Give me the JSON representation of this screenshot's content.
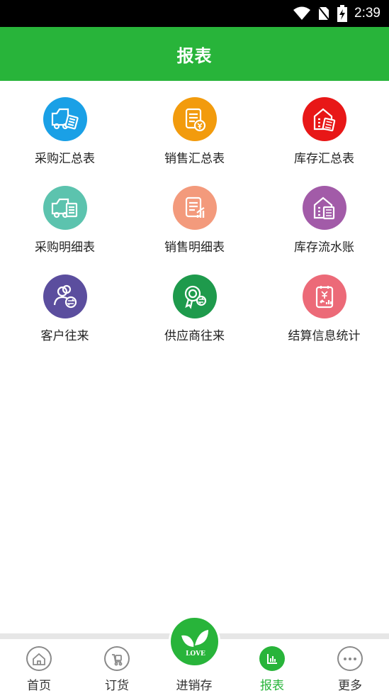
{
  "status_bar": {
    "time": "2:39"
  },
  "header": {
    "title": "报表"
  },
  "colors": {
    "accent": "#28b43a"
  },
  "grid": [
    {
      "label": "采购汇总表",
      "icon": "truck-calculator-icon",
      "color": "#1aa0e6"
    },
    {
      "label": "销售汇总表",
      "icon": "document-yuan-icon",
      "color": "#f29b0d"
    },
    {
      "label": "库存汇总表",
      "icon": "warehouse-calculator-icon",
      "color": "#e81717"
    },
    {
      "label": "采购明细表",
      "icon": "truck-list-icon",
      "color": "#5cc3ae"
    },
    {
      "label": "销售明细表",
      "icon": "document-chart-icon",
      "color": "#f39a7c"
    },
    {
      "label": "库存流水账",
      "icon": "warehouse-list-icon",
      "color": "#a25ba8"
    },
    {
      "label": "客户往来",
      "icon": "customers-exchange-icon",
      "color": "#5b4e9e"
    },
    {
      "label": "供应商往来",
      "icon": "supplier-badge-icon",
      "color": "#1e9a4c"
    },
    {
      "label": "结算信息统计",
      "icon": "clipboard-yuan-chart-icon",
      "color": "#ec6a78"
    }
  ],
  "tabs": [
    {
      "label": "首页",
      "icon": "home-icon"
    },
    {
      "label": "订货",
      "icon": "order-cart-icon"
    },
    {
      "label": "进销存",
      "icon": "leaf-love-icon"
    },
    {
      "label": "报表",
      "icon": "bar-chart-icon"
    },
    {
      "label": "更多",
      "icon": "more-dots-icon"
    }
  ],
  "fab_text": "LOVE"
}
